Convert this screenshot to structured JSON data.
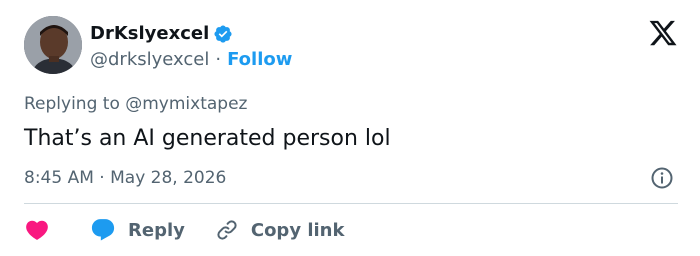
{
  "user": {
    "display_name": "DrKslyexcel",
    "handle": "@drkslyexcel",
    "separator": "·",
    "follow_label": "Follow"
  },
  "tweet": {
    "replying_to": "Replying to @mymixtapez",
    "text": "That’s an AI generated person lol",
    "time": "8:45 AM",
    "meta_separator": "·",
    "date": "May 28, 2026"
  },
  "actions": {
    "reply_label": "Reply",
    "copy_link_label": "Copy link"
  },
  "icons": {
    "verified": "verified-badge-icon",
    "logo": "x-logo-icon",
    "info": "info-icon",
    "like": "heart-icon",
    "reply": "speech-bubble-icon",
    "copy": "link-icon"
  },
  "colors": {
    "accent": "#1d9bf0",
    "like": "#f91880",
    "text": "#0f1419",
    "secondary": "#536471",
    "divider": "#cfd9de"
  }
}
